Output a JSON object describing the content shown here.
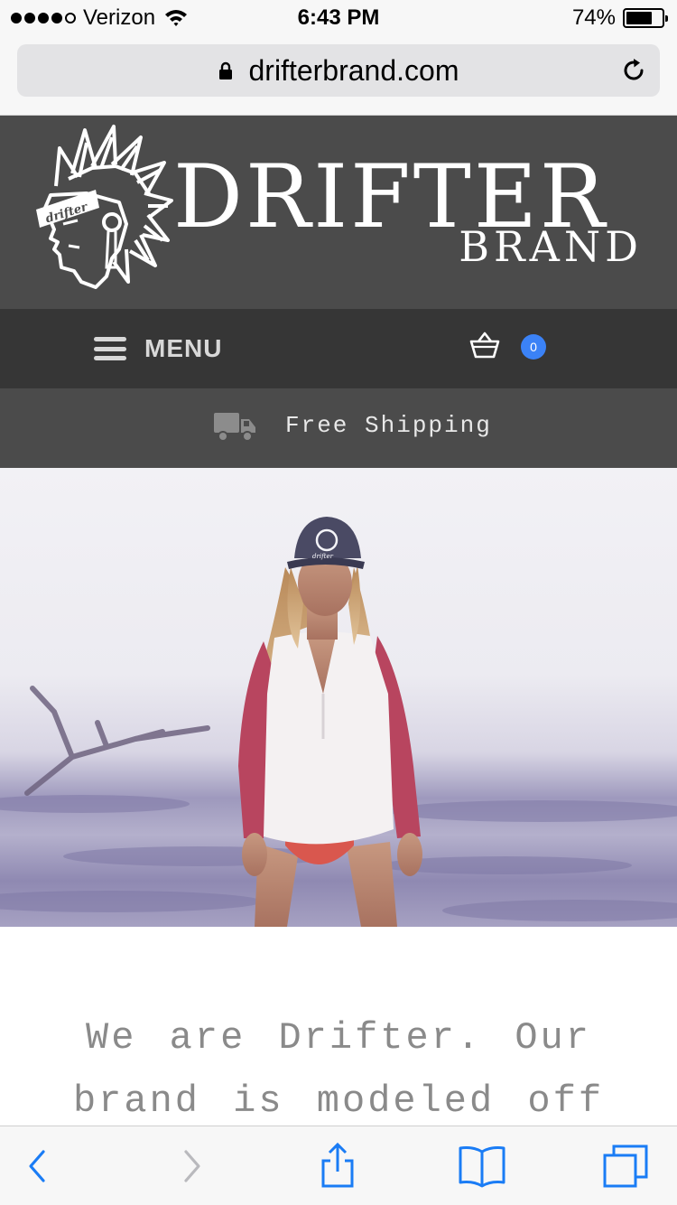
{
  "status_bar": {
    "carrier": "Verizon",
    "time": "6:43 PM",
    "battery_percent_label": "74%",
    "battery_level": 0.74,
    "signal_bars_filled": 4,
    "signal_bars_total": 5
  },
  "browser": {
    "url": "drifterbrand.com",
    "icons": {
      "lock": "lock-icon",
      "reload": "reload-icon"
    }
  },
  "header": {
    "brand_main": "DRIFTER",
    "brand_sub": "BRAND",
    "logo_text": "drifter",
    "background_color": "#4b4b4b"
  },
  "nav": {
    "menu_label": "MENU",
    "cart_count": "0",
    "cart_badge_color": "#3b82f6",
    "icons": {
      "menu": "hamburger-icon",
      "cart": "basket-icon"
    }
  },
  "promo": {
    "shipping_text": "Free Shipping",
    "icon": "truck-icon"
  },
  "hero": {
    "hat_logo_text": "drifter"
  },
  "intro": {
    "text": "We are Drifter. Our brand is modeled off"
  },
  "toolbar": {
    "icons": [
      "back-icon",
      "forward-icon",
      "share-icon",
      "bookmarks-icon",
      "tabs-icon"
    ],
    "accent_color": "#1a7cf5"
  }
}
